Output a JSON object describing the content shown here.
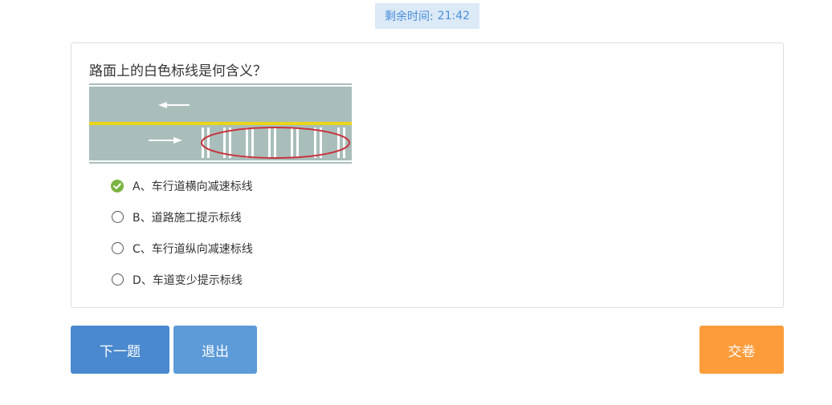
{
  "timer": {
    "label": "剩余时间:",
    "value": "21:42"
  },
  "question": {
    "text": "路面上的白色标线是何含义？",
    "options": [
      {
        "text": "A、车行道横向减速标线",
        "state": "correct",
        "icon": "check-circle-icon"
      },
      {
        "text": "B、道路施工提示标线",
        "state": "unselected",
        "icon": "radio-empty-icon"
      },
      {
        "text": "C、车行道纵向减速标线",
        "state": "unselected",
        "icon": "radio-empty-icon"
      },
      {
        "text": "D、车道变少提示标线",
        "state": "unselected",
        "icon": "radio-empty-icon"
      }
    ]
  },
  "buttons": {
    "next": "下一题",
    "exit": "退出",
    "submit": "交卷"
  },
  "colors": {
    "accent_blue": "#4a89cf",
    "exit_blue": "#5c9ad8",
    "submit_orange": "#fd9c3b",
    "correct_green": "#7cb342",
    "timer_bg": "#dce9f7",
    "timer_text": "#4a90d9"
  }
}
